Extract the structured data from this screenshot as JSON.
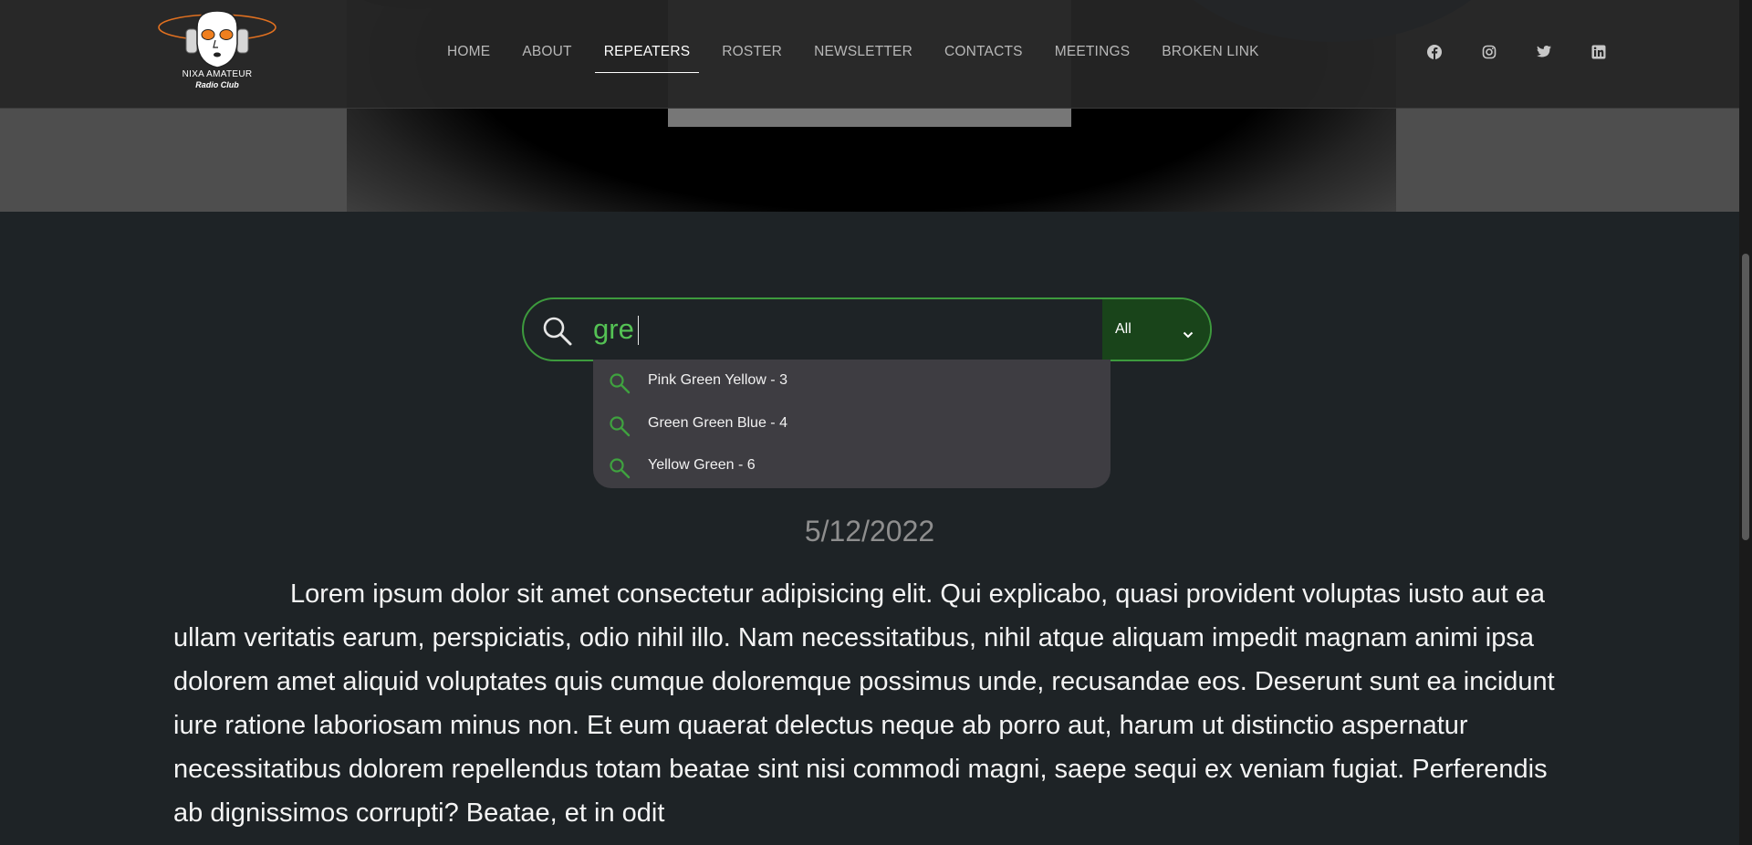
{
  "logo": {
    "line1": "NIXA AMATEUR",
    "line2": "Radio Club"
  },
  "nav": {
    "items": [
      "HOME",
      "ABOUT",
      "REPEATERS",
      "ROSTER",
      "NEWSLETTER",
      "CONTACTS",
      "MEETINGS",
      "BROKEN LINK"
    ],
    "active": "REPEATERS"
  },
  "social": [
    "facebook-icon",
    "instagram-icon",
    "twitter-icon",
    "linkedin-icon"
  ],
  "search": {
    "value": "gre",
    "filter": "All",
    "suggestions": [
      "Pink Green Yellow - 3",
      "Green Green Blue - 4",
      "Yellow Green - 6"
    ]
  },
  "post": {
    "date": "5/12/2022",
    "body": "Lorem ipsum dolor sit amet consectetur adipisicing elit. Qui explicabo, quasi provident voluptas iusto aut ea ullam veritatis earum, perspiciatis, odio nihil illo. Nam necessitatibus, nihil atque aliquam impedit magnam animi ipsa dolorem amet aliquid voluptates quis cumque doloremque possimus unde, recusandae eos. Deserunt sunt ea incidunt iure ratione laboriosam minus non. Et eum quaerat delectus neque ab porro aut, harum ut distinctio aspernatur necessitatibus dolorem repellendus totam beatae sint nisi commodi magni, saepe sequi ex veniam fugiat. Perferendis ab dignissimos corrupti? Beatae, et in odit"
  },
  "colors": {
    "accent": "#3d9a3d",
    "search_text": "#54c254",
    "filter_bg": "#19441a",
    "page_bg": "#1e2326",
    "header_bg": "#262626",
    "suggest_bg": "#3e3d42"
  }
}
